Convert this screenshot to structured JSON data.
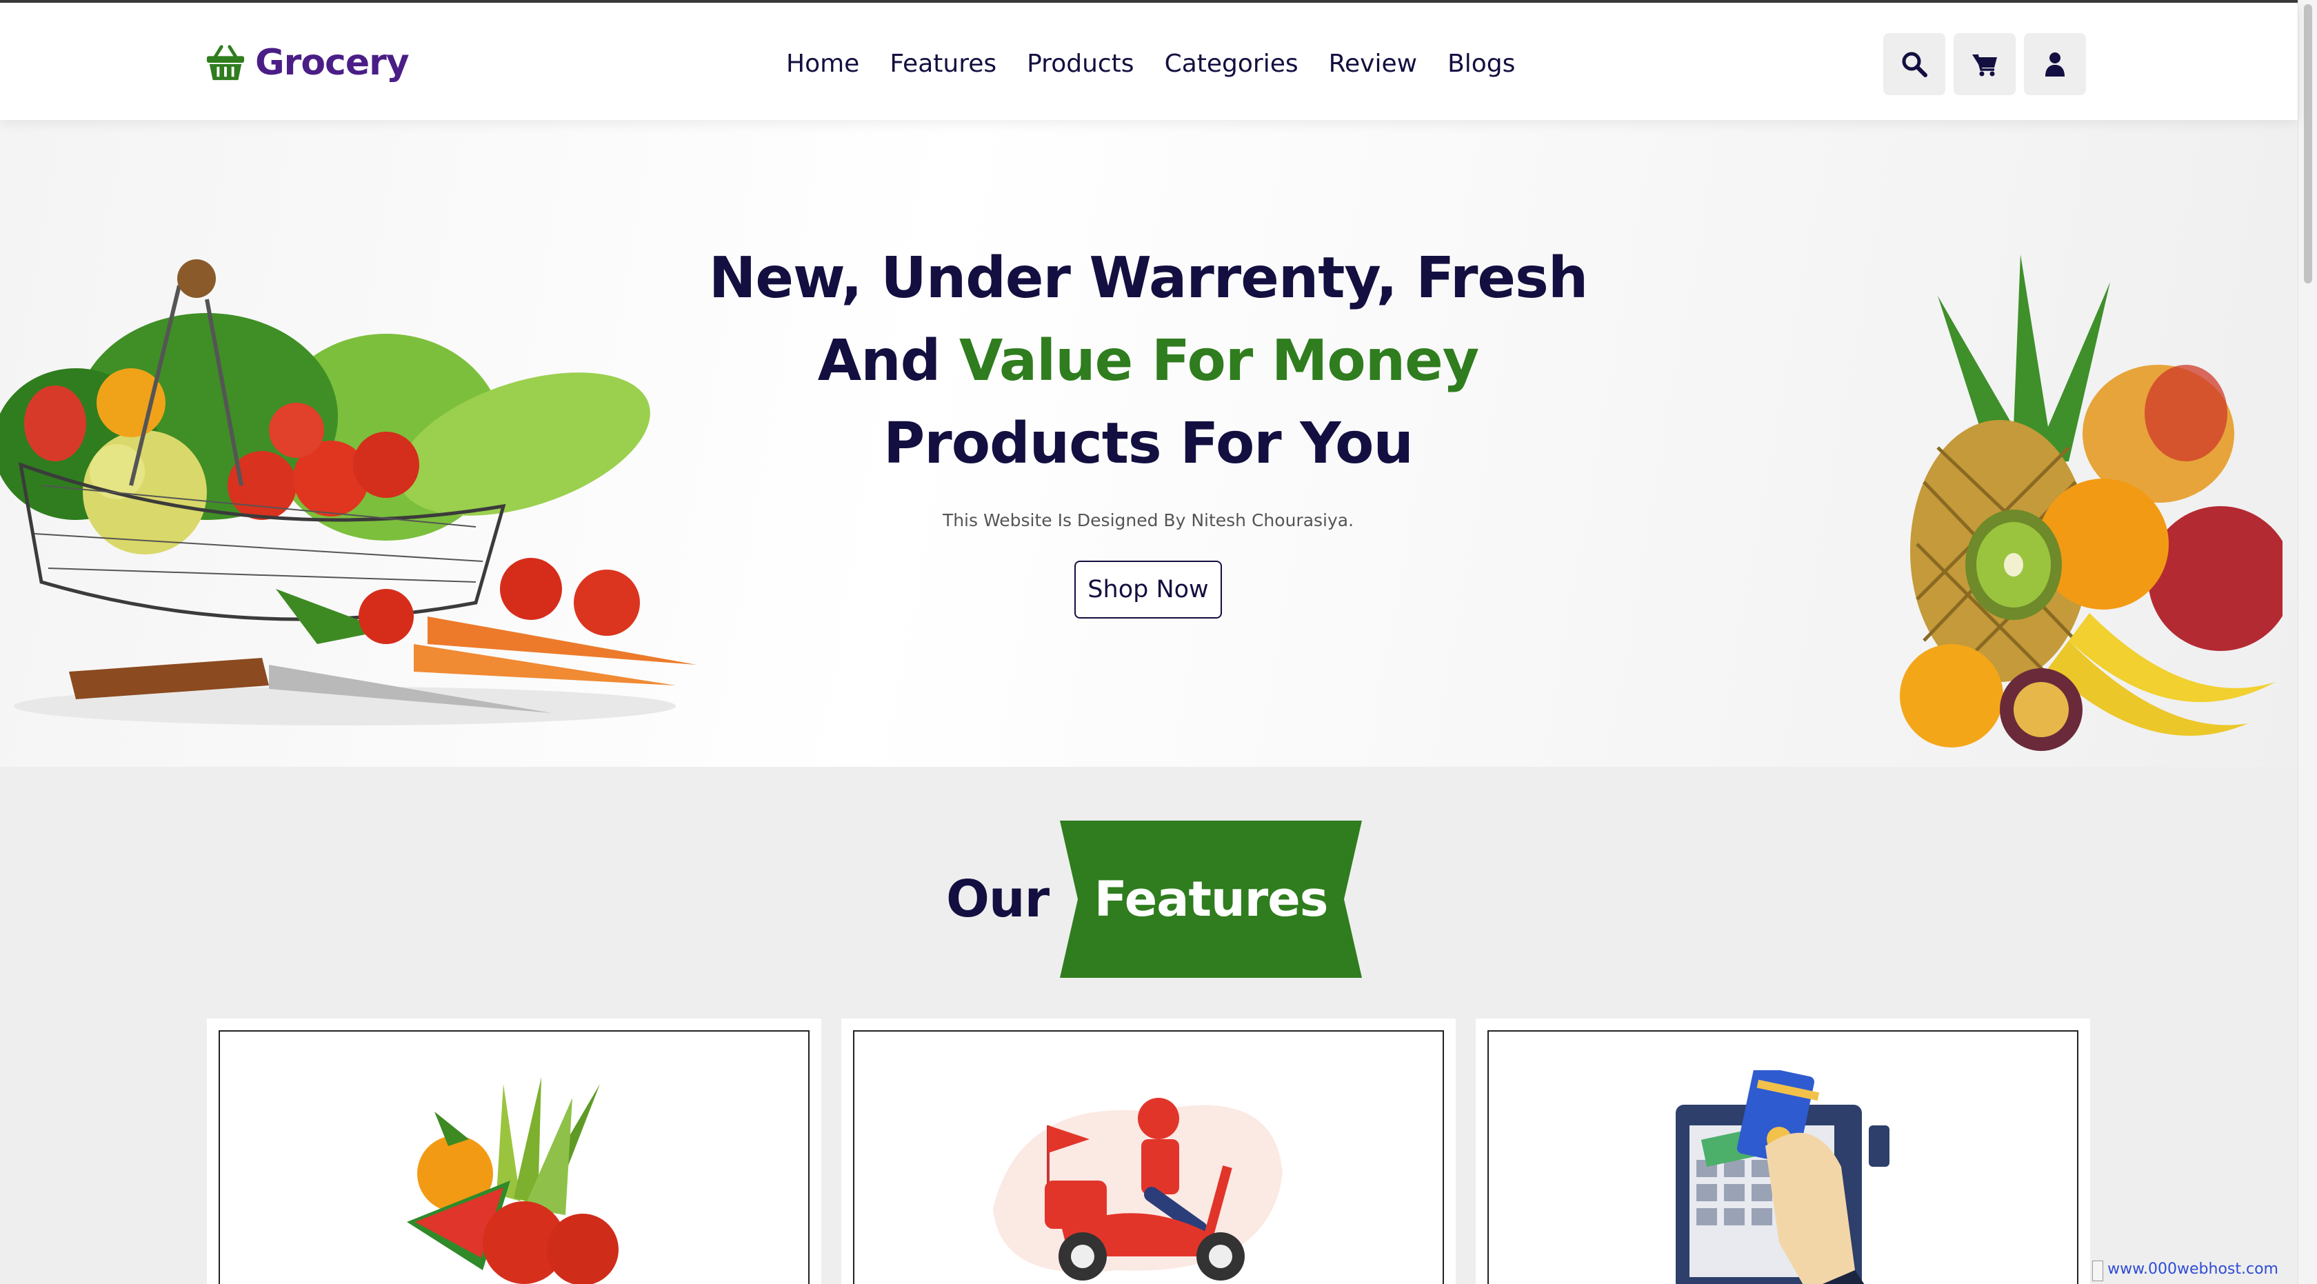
{
  "header": {
    "logo_text": "Grocery",
    "nav": [
      "Home",
      "Features",
      "Products",
      "Categories",
      "Review",
      "Blogs"
    ],
    "icons": [
      "search-icon",
      "shopping-cart-icon",
      "user-icon"
    ]
  },
  "hero": {
    "title_line1": "New, Under Warrenty, Fresh",
    "title_line2_prefix": "And ",
    "title_line2_accent": "Value For Money",
    "title_line3": "Products For You",
    "subtitle": "This Website Is Designed By Nitesh Chourasiya.",
    "cta": "Shop Now"
  },
  "features": {
    "heading_plain": "Our",
    "heading_badge": "Features",
    "cards": [
      {
        "illustration": "fresh-produce-illustration"
      },
      {
        "illustration": "delivery-scooter-illustration"
      },
      {
        "illustration": "card-payment-illustration"
      }
    ]
  },
  "watermark": {
    "text": "www.000webhost.com"
  },
  "colors": {
    "brand": "#4a1e86",
    "accent_green": "#2f7d1e",
    "text_dark": "#130f40"
  }
}
